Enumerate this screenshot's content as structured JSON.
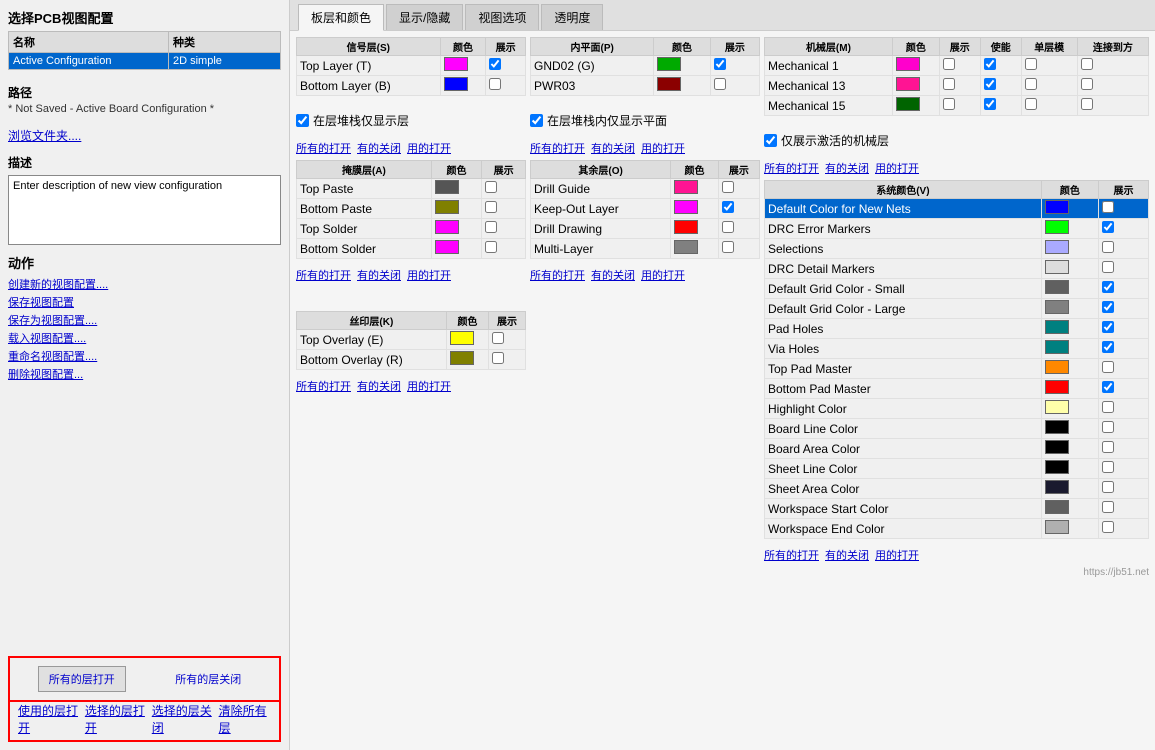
{
  "app": {
    "title": "选择PCB视图配置"
  },
  "left_panel": {
    "title": "选择PCB视图配置",
    "table": {
      "headers": [
        "名称",
        "种类"
      ],
      "rows": [
        {
          "name": "Active Configuration",
          "type": "2D simple",
          "selected": true
        }
      ]
    },
    "path_section": {
      "label": "路径",
      "note": "* Not Saved - Active Board Configuration *"
    },
    "browse_label": "浏览文件夹....",
    "desc_label": "描述",
    "desc_placeholder": "Enter description of new view configuration",
    "actions_label": "动作",
    "actions": [
      "创建新的视图配置....",
      "保存视图配置",
      "保存为视图配置....",
      "载入视图配置....",
      "重命名视图配置....",
      "删除视图配置..."
    ],
    "bottom_buttons": [
      "所有的层打开",
      "所有的层关闭",
      "使用的层打开",
      "选择的层打开",
      "选择的层关闭",
      "清除所有层"
    ]
  },
  "tabs": [
    "板层和颜色",
    "显示/隐藏",
    "视图选项",
    "透明度"
  ],
  "active_tab": "板层和颜色",
  "signal_layers": {
    "header": "信号层(S)",
    "col_headers": [
      "信号层(S)",
      "颜色",
      "展示"
    ],
    "rows": [
      {
        "name": "Top Layer (T)",
        "color": "magenta",
        "checked": true
      },
      {
        "name": "Bottom Layer (B)",
        "color": "blue",
        "checked": false
      }
    ]
  },
  "inner_layers": {
    "header": "内平面(P)",
    "col_headers": [
      "内平面(P)",
      "颜色",
      "展示"
    ],
    "rows": [
      {
        "name": "GND02 (G)",
        "color": "green",
        "checked": true
      },
      {
        "name": "PWR03",
        "color": "darkred",
        "checked": false
      }
    ]
  },
  "mechanical_layers": {
    "header": "机械层(M)",
    "col_headers": [
      "机械层(M)",
      "颜色",
      "展示",
      "使能",
      "单层模",
      "连接到方"
    ],
    "rows": [
      {
        "name": "Mechanical 1",
        "color": "magenta2",
        "show": false,
        "enable": true,
        "single": false,
        "connect": false
      },
      {
        "name": "Mechanical 13",
        "color": "pink",
        "show": false,
        "enable": true,
        "single": false,
        "connect": false
      },
      {
        "name": "Mechanical 15",
        "color": "darkgreen",
        "show": false,
        "enable": true,
        "single": false,
        "connect": false
      }
    ]
  },
  "stack_only_checkbox1": "在层堆栈仅显示层",
  "stack_only_checkbox2": "在层堆栈内仅显示平面",
  "mech_active_checkbox": "仅展示激活的机械层",
  "mask_layers": {
    "header": "掩膜层(A)",
    "col_headers": [
      "掩膜层(A)",
      "颜色",
      "展示"
    ],
    "rows": [
      {
        "name": "Top Paste",
        "color": "darkgray2",
        "checked": false
      },
      {
        "name": "Bottom Paste",
        "color": "olive",
        "checked": false
      },
      {
        "name": "Top Solder",
        "color": "magenta",
        "checked": false
      },
      {
        "name": "Bottom Solder",
        "color": "magenta",
        "checked": false
      }
    ]
  },
  "other_layers": {
    "header": "其余层(O)",
    "col_headers": [
      "其余层(O)",
      "颜色",
      "展示"
    ],
    "rows": [
      {
        "name": "Drill Guide",
        "color": "pink",
        "checked": false
      },
      {
        "name": "Keep-Out Layer",
        "color": "magenta",
        "checked": true
      },
      {
        "name": "Drill Drawing",
        "color": "red",
        "checked": false
      },
      {
        "name": "Multi-Layer",
        "color": "gray",
        "checked": false
      }
    ]
  },
  "silkscreen_layers": {
    "header": "丝印层(K)",
    "col_headers": [
      "丝印层(K)",
      "颜色",
      "展示"
    ],
    "rows": [
      {
        "name": "Top Overlay (E)",
        "color": "yellow",
        "checked": false
      },
      {
        "name": "Bottom Overlay (R)",
        "color": "olive",
        "checked": false
      }
    ]
  },
  "system_colors": {
    "header": "系统颜色(V)",
    "col_headers": [
      "系统颜色(V)",
      "颜色",
      "展示"
    ],
    "rows": [
      {
        "name": "Default Color for New Nets",
        "color": "blue",
        "checked": false,
        "selected": true
      },
      {
        "name": "DRC Error Markers",
        "color": "lime",
        "checked": true
      },
      {
        "name": "Selections",
        "color": "none",
        "checked": false
      },
      {
        "name": "DRC Detail Markers",
        "color": "none",
        "checked": false
      },
      {
        "name": "Default Grid Color - Small",
        "color": "darkgray",
        "checked": true
      },
      {
        "name": "Default Grid Color - Large",
        "color": "darkgray",
        "checked": true
      },
      {
        "name": "Pad Holes",
        "color": "teal",
        "checked": true
      },
      {
        "name": "Via Holes",
        "color": "teal",
        "checked": true
      },
      {
        "name": "Top Pad Master",
        "color": "orange",
        "checked": false
      },
      {
        "name": "Bottom Pad Master",
        "color": "red",
        "checked": true
      },
      {
        "name": "Highlight Color",
        "color": "none",
        "checked": false
      },
      {
        "name": "Board Line Color",
        "color": "black",
        "checked": false
      },
      {
        "name": "Board Area Color",
        "color": "black",
        "checked": false
      },
      {
        "name": "Sheet Line Color",
        "color": "black",
        "checked": false
      },
      {
        "name": "Sheet Area Color",
        "color": "none",
        "checked": false
      },
      {
        "name": "Workspace Start Color",
        "color": "medgray",
        "checked": false
      },
      {
        "name": "Workspace End Color",
        "color": "lightgray",
        "checked": false
      }
    ]
  },
  "link_labels": {
    "all_on": "所有的打开",
    "all_off": "有的关闭",
    "used_on": "用的打开"
  }
}
